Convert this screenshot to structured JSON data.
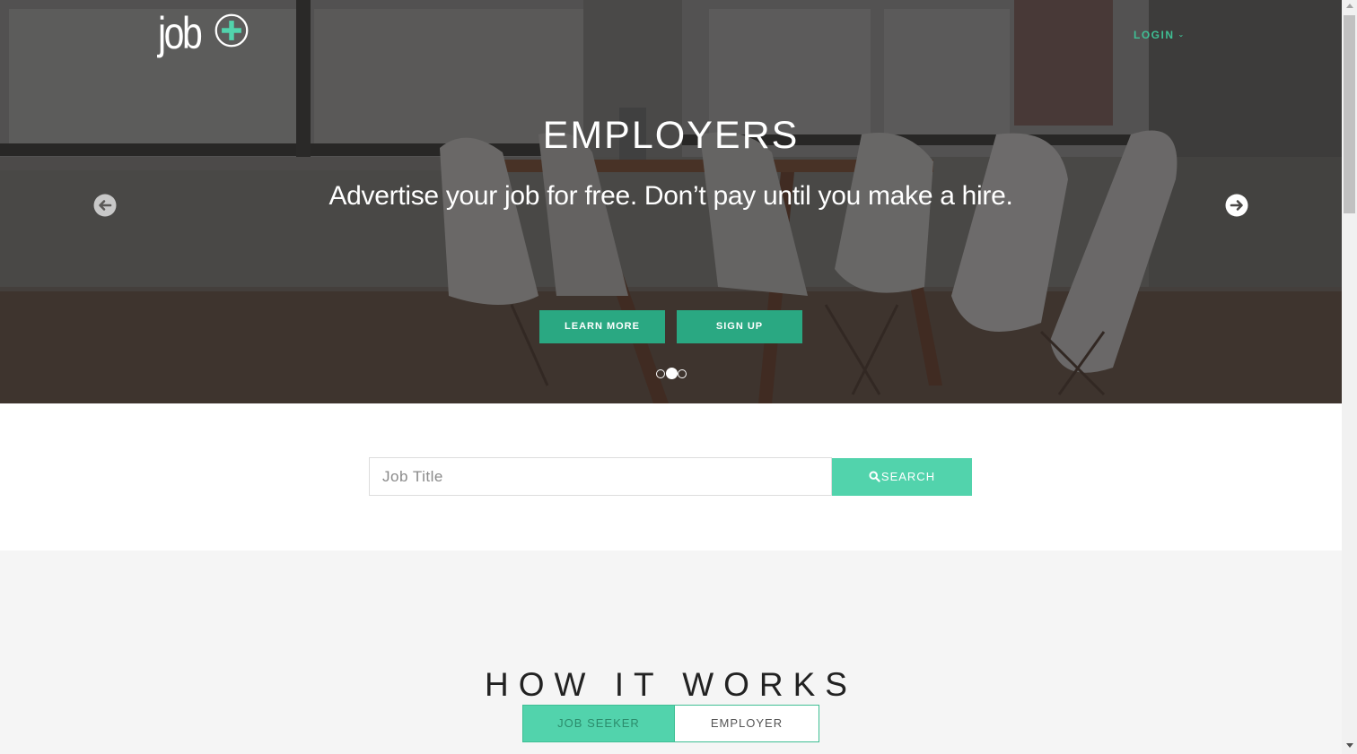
{
  "header": {
    "logo_text": "job",
    "logo_icon": "plus-circle-icon",
    "login_label": "LOGIN",
    "login_caret_icon": "chevron-down-icon"
  },
  "hero": {
    "title": "EMPLOYERS",
    "subtitle": "Advertise your job for free. Don’t pay until you make a hire.",
    "prev_icon": "arrow-left-circle-icon",
    "next_icon": "arrow-right-circle-icon",
    "learn_more_label": "LEARN MORE",
    "sign_up_label": "SIGN UP",
    "slides_total": 3,
    "active_slide": 2
  },
  "search": {
    "placeholder": "Job Title",
    "value": "",
    "button_label": "SEARCH",
    "button_icon": "search-icon"
  },
  "how_it_works": {
    "title": "HOW IT WORKS",
    "tabs": [
      {
        "label": "JOB SEEKER",
        "active": true
      },
      {
        "label": "EMPLOYER",
        "active": false
      }
    ]
  },
  "colors": {
    "accent": "#52d3ac",
    "accent_dark": "#2aa882",
    "login_text": "#3fbf94",
    "section_bg": "#f5f5f5"
  }
}
